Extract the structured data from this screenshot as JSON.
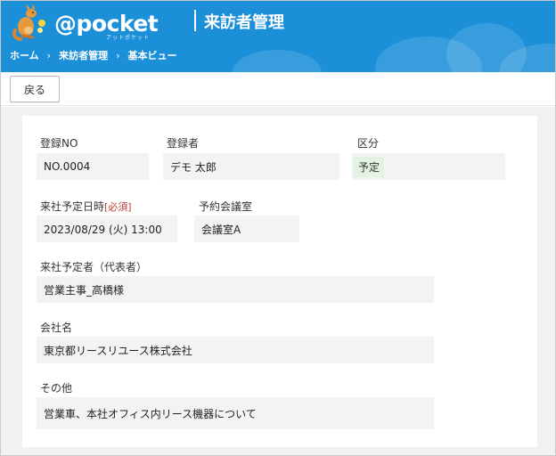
{
  "header": {
    "logo_text": "@pocket",
    "logo_sub": "アットポケット",
    "title": "来訪者管理"
  },
  "breadcrumb": {
    "items": [
      "ホーム",
      "来訪者管理",
      "基本ビュー"
    ],
    "separator": "›"
  },
  "toolbar": {
    "back_label": "戻る"
  },
  "form": {
    "reg_no": {
      "label": "登録NO",
      "value": "NO.0004"
    },
    "registrant": {
      "label": "登録者",
      "value": "デモ 太郎"
    },
    "category": {
      "label": "区分",
      "value": "予定"
    },
    "visit_datetime": {
      "label": "来社予定日時",
      "required": "[必須]",
      "value": "2023/08/29 (火) 13:00"
    },
    "meeting_room": {
      "label": "予約会議室",
      "value": "会議室A"
    },
    "visitor": {
      "label": "来社予定者（代表者）",
      "value": "営業主事_高橋様"
    },
    "company": {
      "label": "会社名",
      "value": "東京都リースリユース株式会社"
    },
    "other": {
      "label": "その他",
      "value": "営業車、本社オフィス内リース機器について"
    }
  },
  "colors": {
    "header_bg": "#1b8fd8",
    "required": "#c0392b",
    "badge_bg": "#e3f3e3"
  }
}
